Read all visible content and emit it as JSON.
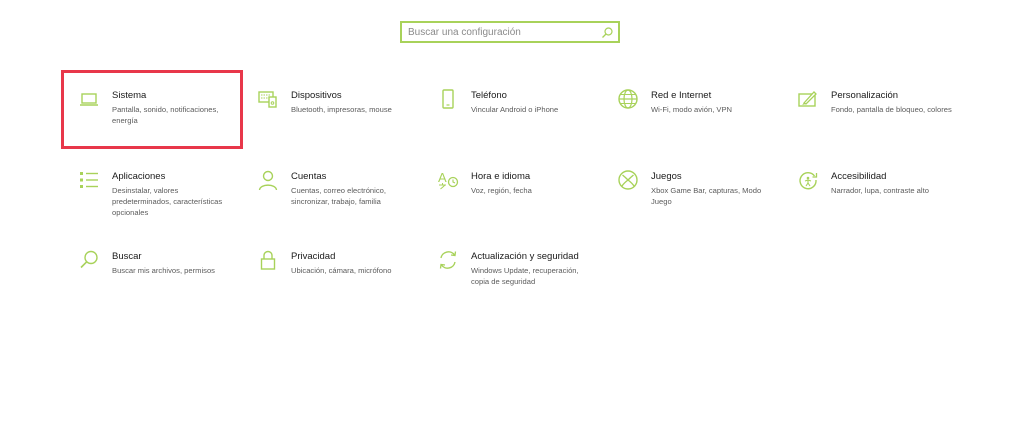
{
  "search": {
    "placeholder": "Buscar una configuración",
    "icon": "search-icon"
  },
  "colors": {
    "accent": "#a8d25a",
    "highlight": "#e8374a"
  },
  "tiles": [
    {
      "title": "Sistema",
      "desc": "Pantalla, sonido, notificaciones, energía",
      "icon": "laptop-icon"
    },
    {
      "title": "Dispositivos",
      "desc": "Bluetooth, impresoras, mouse",
      "icon": "keyboard-icon"
    },
    {
      "title": "Teléfono",
      "desc": "Vincular Android o iPhone",
      "icon": "phone-icon"
    },
    {
      "title": "Red e Internet",
      "desc": "Wi-Fi, modo avión, VPN",
      "icon": "globe-icon"
    },
    {
      "title": "Personalización",
      "desc": "Fondo, pantalla de bloqueo, colores",
      "icon": "paint-icon"
    },
    {
      "title": "Aplicaciones",
      "desc": "Desinstalar, valores predeterminados, características opcionales",
      "icon": "apps-list-icon"
    },
    {
      "title": "Cuentas",
      "desc": "Cuentas, correo electrónico, sincronizar, trabajo, familia",
      "icon": "person-icon"
    },
    {
      "title": "Hora e idioma",
      "desc": "Voz, región, fecha",
      "icon": "time-language-icon"
    },
    {
      "title": "Juegos",
      "desc": "Xbox Game Bar, capturas, Modo Juego",
      "icon": "xbox-icon"
    },
    {
      "title": "Accesibilidad",
      "desc": "Narrador, lupa, contraste alto",
      "icon": "accessibility-icon"
    },
    {
      "title": "Buscar",
      "desc": "Buscar mis archivos, permisos",
      "icon": "magnifier-icon"
    },
    {
      "title": "Privacidad",
      "desc": "Ubicación, cámara, micrófono",
      "icon": "lock-icon"
    },
    {
      "title": "Actualización y seguridad",
      "desc": "Windows Update, recuperación, copia de seguridad",
      "icon": "refresh-icon"
    }
  ]
}
